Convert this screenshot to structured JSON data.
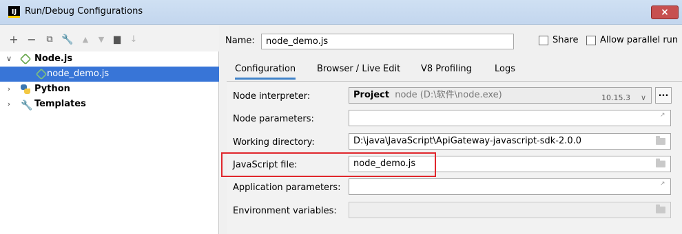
{
  "window": {
    "title": "Run/Debug Configurations",
    "close": "×",
    "app_icon": "IJ"
  },
  "toolbar": {
    "icons": [
      "add-icon",
      "remove-icon",
      "copy-icon",
      "wrench-icon",
      "move-up-icon",
      "move-down-icon",
      "folder-add-icon",
      "sort-icon"
    ]
  },
  "tree": {
    "nodejs": {
      "label": "Node.js",
      "expanded": true
    },
    "node_demo": {
      "label": "node_demo.js",
      "selected": true
    },
    "python": {
      "label": "Python",
      "expanded": false
    },
    "templates": {
      "label": "Templates",
      "expanded": false
    }
  },
  "header": {
    "name_label": "Name:",
    "name_value": "node_demo.js",
    "share_label": "Share",
    "parallel_label": "Allow parallel run"
  },
  "tabs": [
    {
      "label": "Configuration",
      "active": true
    },
    {
      "label": "Browser / Live Edit",
      "active": false
    },
    {
      "label": "V8 Profiling",
      "active": false
    },
    {
      "label": "Logs",
      "active": false
    }
  ],
  "fields": {
    "interpreter": {
      "label": "Node interpreter:",
      "project": "Project",
      "value": "node (D:\\软件\\node.exe)",
      "version": "10.15.3",
      "more": "..."
    },
    "node_params": {
      "label": "Node parameters:",
      "value": ""
    },
    "working_dir": {
      "label": "Working directory:",
      "value": "D:\\java\\JavaScript\\ApiGateway-javascript-sdk-2.0.0"
    },
    "js_file": {
      "label": "JavaScript file:",
      "value": "node_demo.js"
    },
    "app_params": {
      "label": "Application parameters:",
      "value": ""
    },
    "env_vars": {
      "label": "Environment variables:",
      "value": ""
    }
  },
  "colors": {
    "selection": "#3875d7",
    "highlight_box": "#e0262c",
    "active_tab": "#4083c9"
  }
}
